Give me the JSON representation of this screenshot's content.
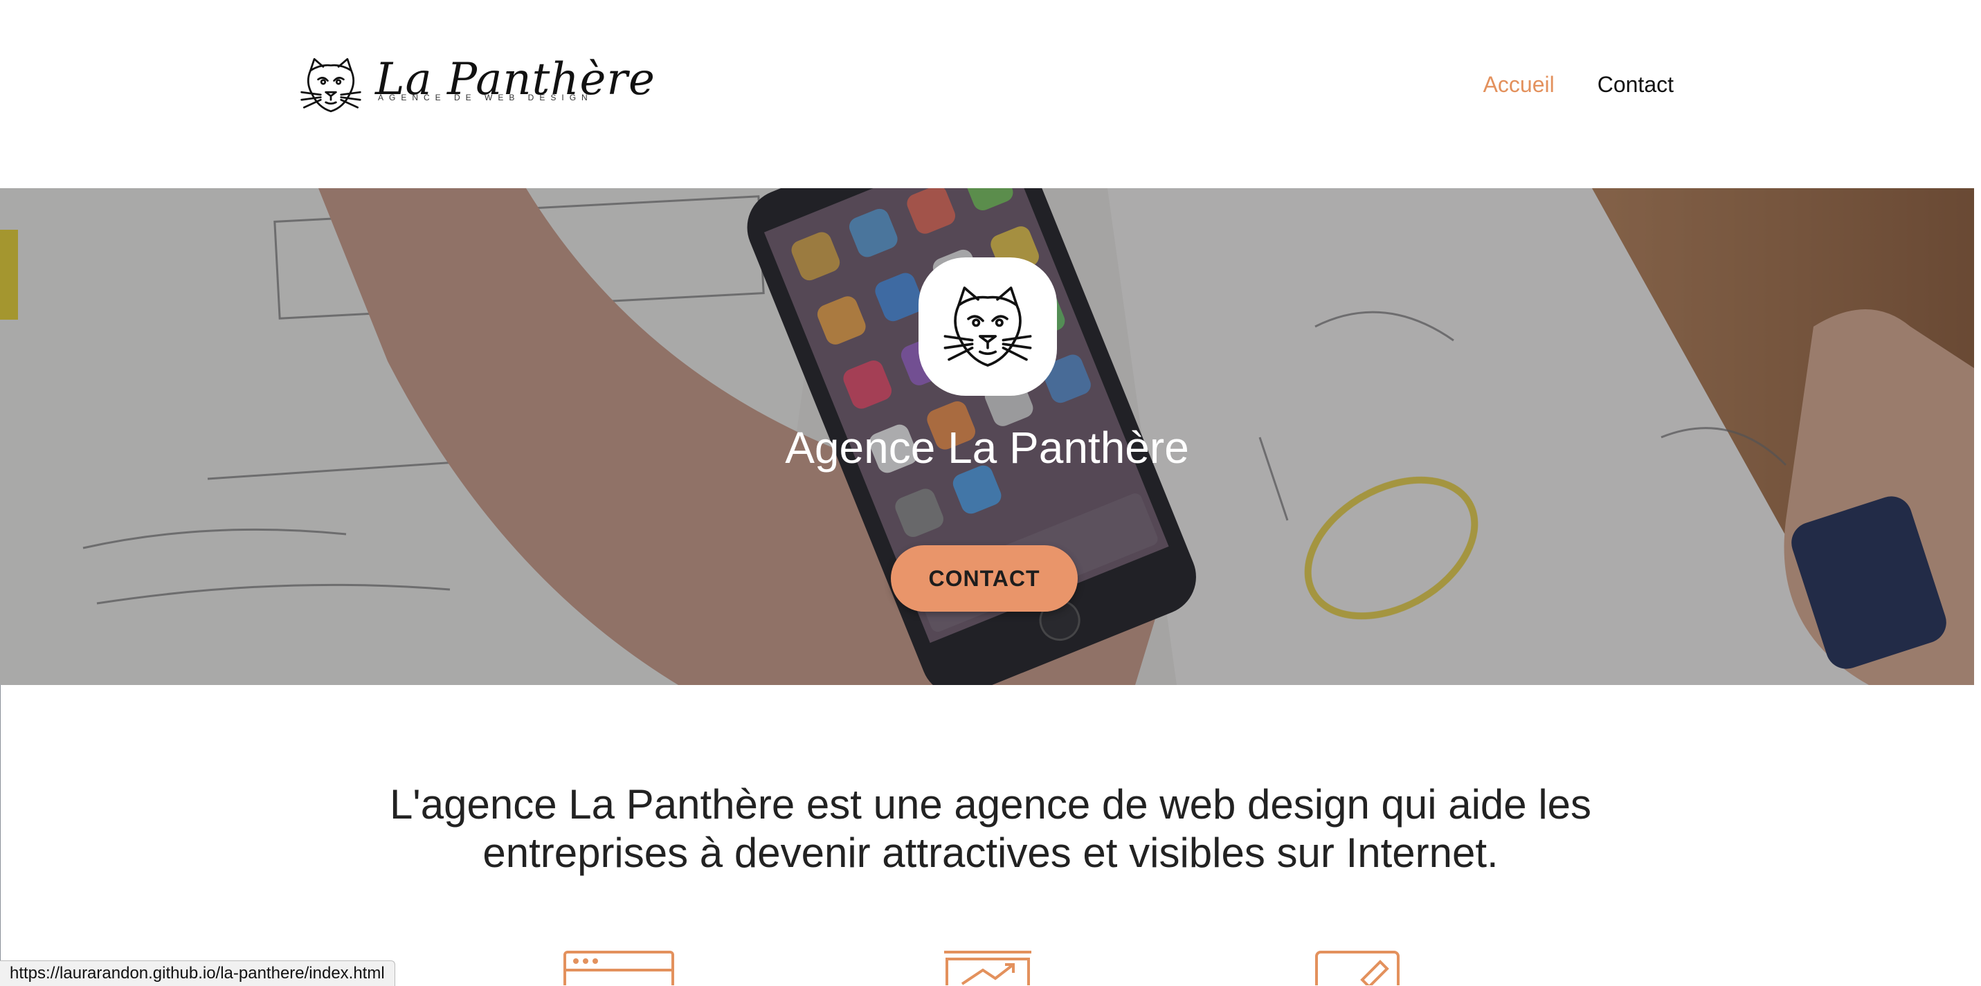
{
  "header": {
    "logo_title": "La Panthère",
    "logo_subtitle": "AGENCE DE WEB DESIGN",
    "nav": [
      {
        "label": "Accueil",
        "active": true
      },
      {
        "label": "Contact",
        "active": false
      }
    ]
  },
  "hero": {
    "title": "Agence La Panthère",
    "button_label": "CONTACT"
  },
  "intro": {
    "text_line1": "L'agence La Panthère est une agence de web design qui aide les",
    "text_line2": "entreprises à devenir attractives et visibles sur Internet."
  },
  "status_bar": {
    "url": "https://laurarandon.github.io/la-panthere/index.html"
  },
  "colors": {
    "accent": "#e3915d",
    "button": "#e9956a",
    "text": "#222222"
  },
  "icons": [
    "panther-logo-icon",
    "browser-window-icon",
    "growth-chart-icon",
    "edit-pencil-icon"
  ]
}
